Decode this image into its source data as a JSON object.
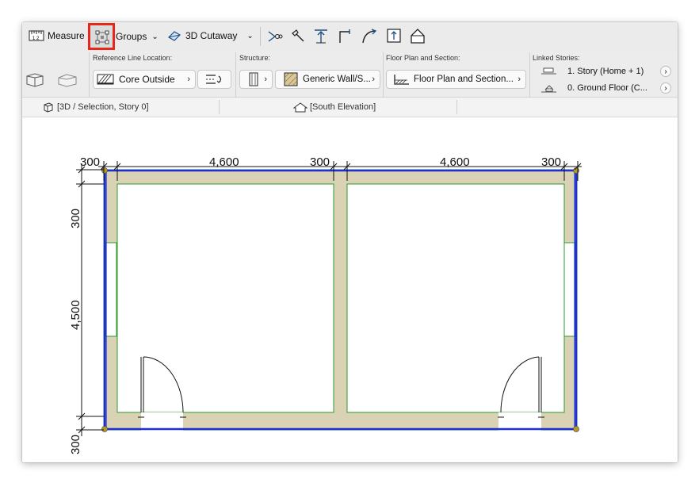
{
  "toolbar": {
    "measure_label": "Measure",
    "groups_label": "Groups",
    "cutaway_label": "3D Cutaway"
  },
  "infobox": {
    "ref_line_title": "Reference Line Location:",
    "ref_line_value": "Core Outside",
    "structure_title": "Structure:",
    "structure_value": "Generic Wall/S...",
    "floorplan_title": "Floor Plan and Section:",
    "floorplan_value": "Floor Plan and Section...",
    "linked_title": "Linked Stories:",
    "linked_top": "1. Story (Home + 1)",
    "linked_bottom": "0. Ground Floor (C..."
  },
  "tabs": {
    "tab1": "[3D / Selection, Story 0]",
    "tab2": "[South Elevation]"
  },
  "dimensions": {
    "top": [
      "300",
      "4,600",
      "300",
      "4,600",
      "300"
    ],
    "left": [
      "300",
      "4,500",
      "300"
    ]
  },
  "colors": {
    "wall_fill": "#d9d2b5",
    "wall_green_edge": "#2c9a2c",
    "selection_blue": "#1f2fcf",
    "highlight_red": "#e8261a"
  }
}
